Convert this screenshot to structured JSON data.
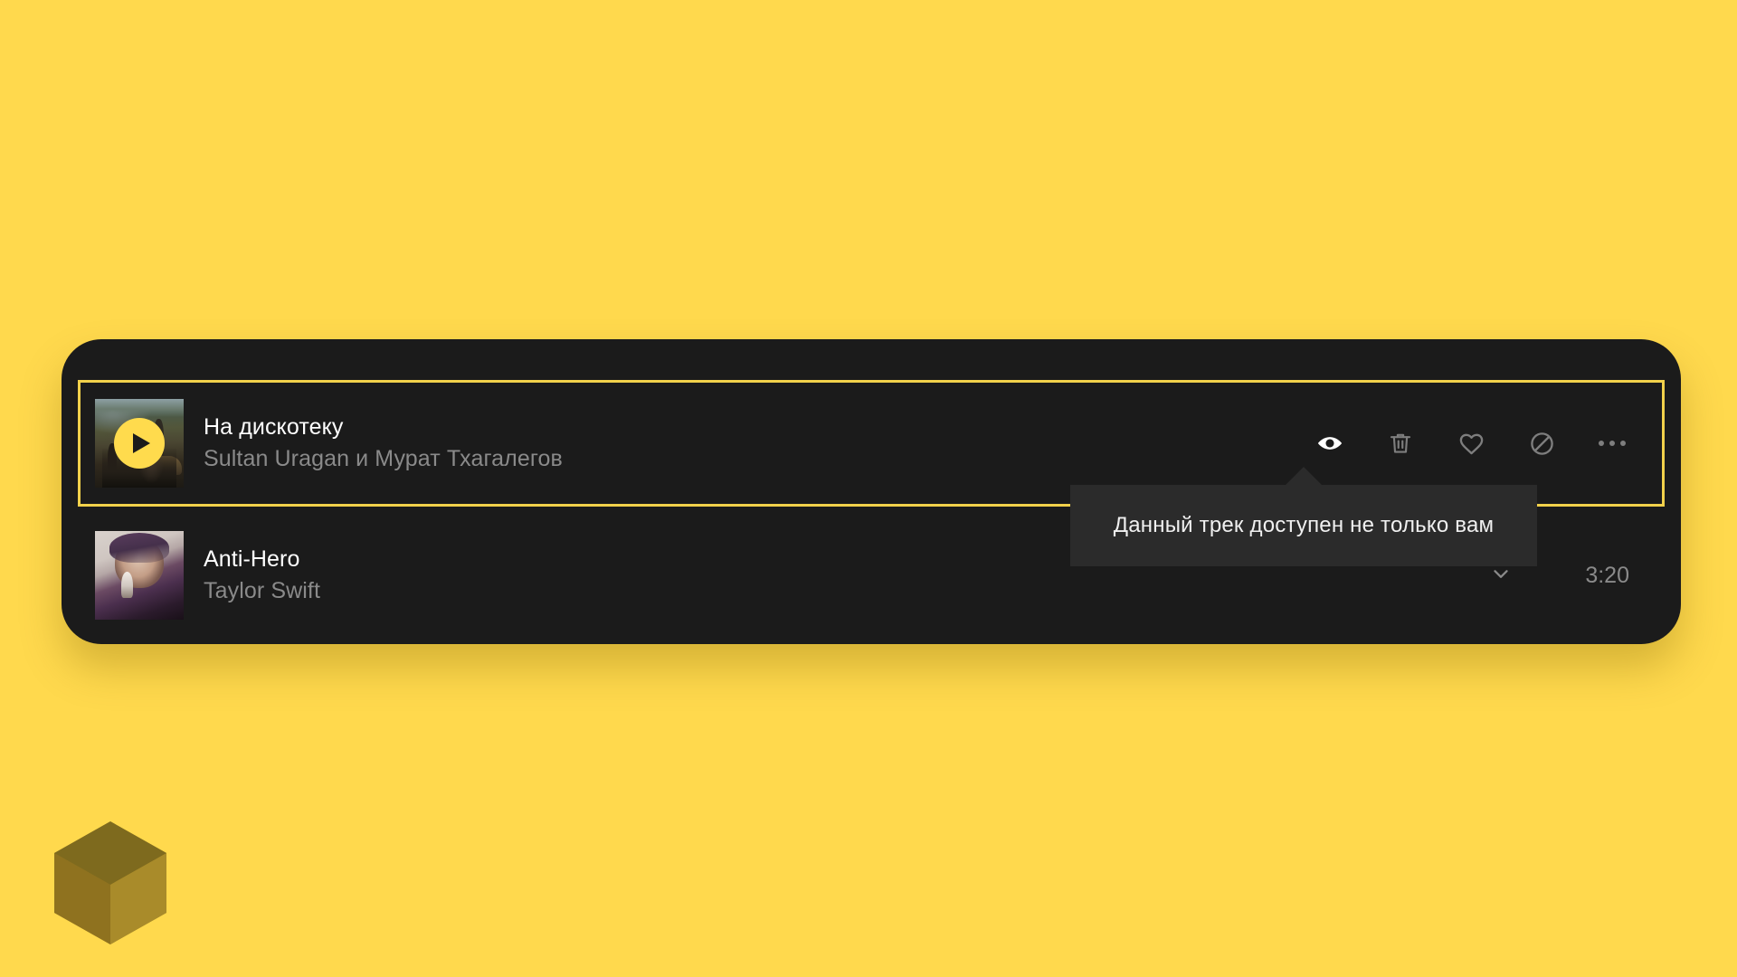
{
  "page": {
    "background_color": "#FFD94D",
    "card_background": "#1B1B1B",
    "accent_color": "#F2D14B"
  },
  "track_list": {
    "rows": [
      {
        "title": "На дискотеку",
        "artist": "Sultan Uragan и Мурат Тхагалегов",
        "selected": true,
        "playing": true,
        "play_icon": "play-icon",
        "duration": "",
        "actions": [
          {
            "icon": "eye-icon",
            "name": "visibility-toggle",
            "active": true
          },
          {
            "icon": "trash-icon",
            "name": "delete-track",
            "active": false
          },
          {
            "icon": "heart-icon",
            "name": "like-track",
            "active": false
          },
          {
            "icon": "block-icon",
            "name": "block-track",
            "active": false
          },
          {
            "icon": "more-dots-icon",
            "name": "more-options",
            "active": false
          }
        ]
      },
      {
        "title": "Anti-Hero",
        "artist": "Taylor Swift",
        "selected": false,
        "playing": false,
        "duration": "3:20",
        "chevron_icon": "chevron-down-icon"
      }
    ]
  },
  "tooltip": {
    "text": "Данный трек доступен не только вам",
    "anchor_icon": "eye-icon",
    "background": "#2B2B2B"
  },
  "logo": {
    "name": "cube-logo",
    "top_color": "#7E6A1E",
    "left_color": "#9C7C20",
    "right_color": "#A98B2A"
  }
}
